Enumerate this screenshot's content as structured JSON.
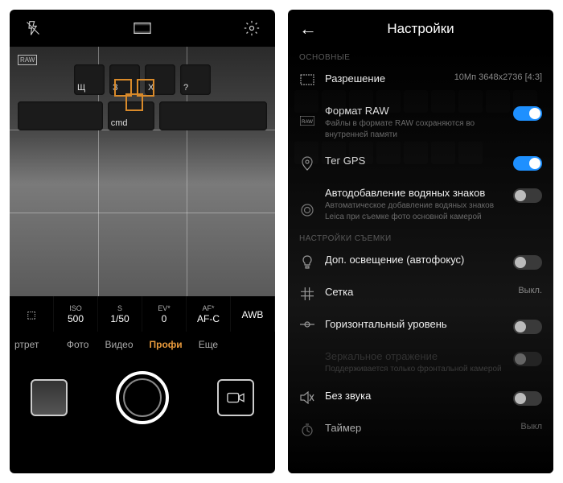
{
  "left": {
    "raw_badge": "RAW",
    "params": [
      {
        "label": "",
        "value": "⬚"
      },
      {
        "label": "ISO",
        "value": "500"
      },
      {
        "label": "S",
        "value": "1/50"
      },
      {
        "label": "EV*",
        "value": "0"
      },
      {
        "label": "AF*",
        "value": "AF-C"
      },
      {
        "label": "",
        "value": "AWB"
      }
    ],
    "modes": {
      "cut_left": "ртрет",
      "items": [
        "Фото",
        "Видео",
        "Профи",
        "Еще"
      ],
      "active_index": 2
    },
    "viewfinder_keys_row1": [
      "Щ",
      "З",
      "Х",
      "?"
    ],
    "viewfinder_keys_row2": [
      "cmd"
    ]
  },
  "right": {
    "title": "Настройки",
    "section1": "ОСНОВНЫЕ",
    "resolution": {
      "label": "Разрешение",
      "value": "10Мп 3648x2736 [4:3]"
    },
    "raw": {
      "title": "Формат RAW",
      "sub": "Файлы в формате RAW сохраняются во внутренней памяти",
      "on": true
    },
    "gps": {
      "title": "Тег GPS",
      "on": true
    },
    "watermark": {
      "title": "Автодобавление водяных знаков",
      "sub": "Автоматическое добавление водяных знаков Leica при съемке фото основной камерой",
      "on": false
    },
    "section2": "НАСТРОЙКИ СЪЕМКИ",
    "lighting": {
      "title": "Доп. освещение (автофокус)",
      "on": false
    },
    "grid": {
      "title": "Сетка",
      "value": "Выкл."
    },
    "horizon": {
      "title": "Горизонтальный уровень",
      "on": false
    },
    "mirror": {
      "title": "Зеркальное отражение",
      "sub": "Поддерживается только фронтальной камерой",
      "on": false
    },
    "mute": {
      "title": "Без звука",
      "on": false
    },
    "timer": {
      "title": "Таймер",
      "value": "Выкл"
    }
  }
}
